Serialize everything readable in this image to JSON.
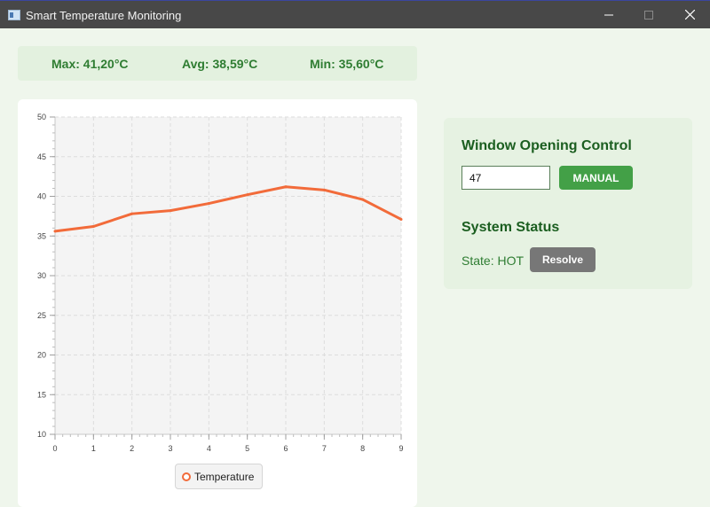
{
  "window": {
    "title": "Smart Temperature Monitoring",
    "icon": "app-window-icon",
    "controls": [
      "minimize-icon",
      "maximize-icon",
      "close-icon"
    ]
  },
  "stats": {
    "max": "Max: 41,20°C",
    "avg": "Avg: 38,59°C",
    "min": "Min: 35,60°C"
  },
  "chart_data": {
    "type": "line",
    "x": [
      0,
      1,
      2,
      3,
      4,
      5,
      6,
      7,
      8,
      9
    ],
    "series": [
      {
        "name": "Temperature",
        "values": [
          35.6,
          36.2,
          37.8,
          38.2,
          39.1,
          40.2,
          41.2,
          40.8,
          39.6,
          37.1
        ],
        "color": "#f26b3a"
      }
    ],
    "xlim": [
      0,
      9
    ],
    "ylim": [
      10,
      50
    ],
    "xticks": [
      "0",
      "1",
      "2",
      "3",
      "4",
      "5",
      "6",
      "7",
      "8",
      "9"
    ],
    "yticks": [
      "10",
      "15",
      "20",
      "25",
      "30",
      "35",
      "40",
      "45",
      "50"
    ],
    "grid": true,
    "legend_position": "bottom"
  },
  "control": {
    "title": "Window Opening Control",
    "opening_value": "47",
    "manual_label": "MANUAL"
  },
  "status": {
    "title": "System Status",
    "state": "State: HOT",
    "resolve_label": "Resolve"
  },
  "colors": {
    "accent": "#43a047",
    "heading": "#1b5e20",
    "series": "#f26b3a",
    "resolve": "#777777"
  }
}
